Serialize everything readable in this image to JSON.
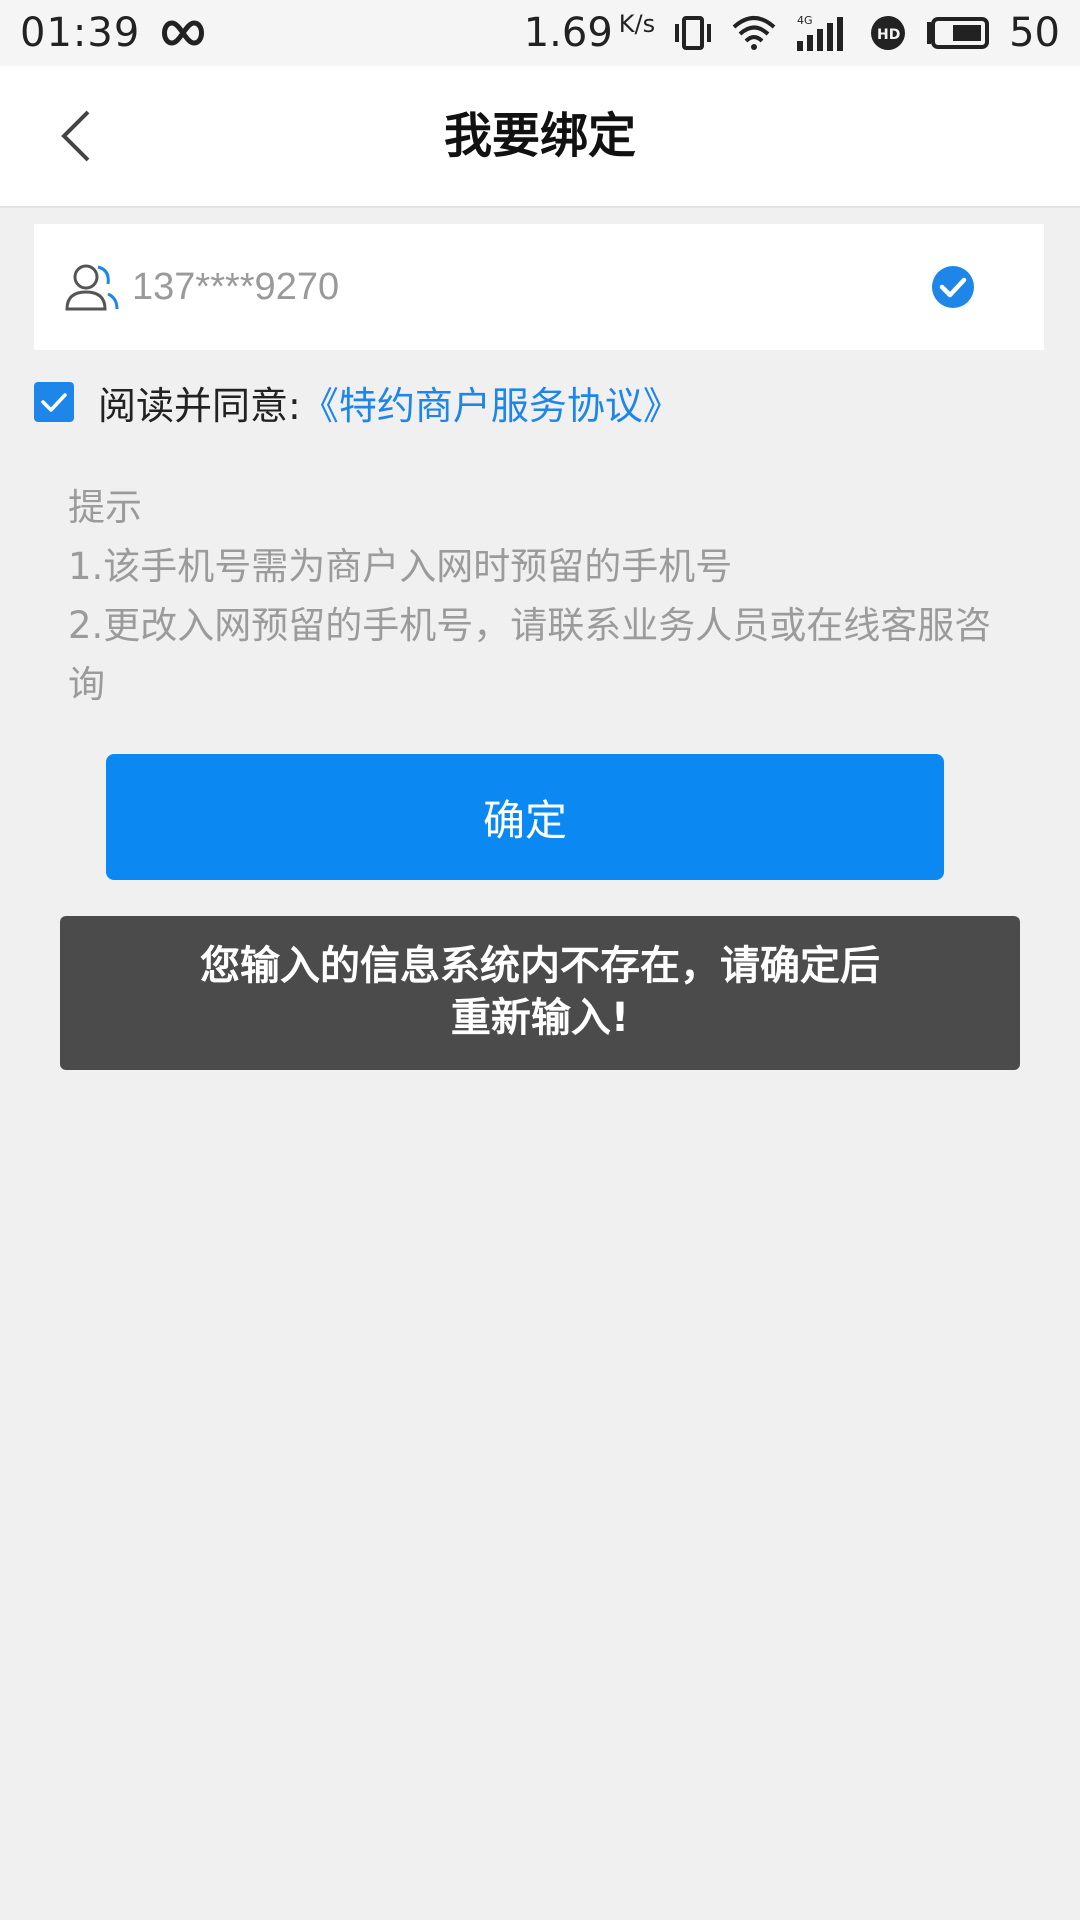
{
  "status_bar": {
    "time": "01:39",
    "speed": "1.69",
    "speed_unit": "K/s",
    "battery": "50",
    "network": "4G"
  },
  "header": {
    "title": "我要绑定"
  },
  "phone": {
    "value": "137****9270"
  },
  "agreement": {
    "prefix": "阅读并同意:",
    "link": "《特约商户服务协议》",
    "checked": true
  },
  "tips": {
    "title": "提示",
    "line1": "1.该手机号需为商户入网时预留的手机号",
    "line2": "2.更改入网预留的手机号，请联系业务人员或在线客服咨询"
  },
  "confirm": {
    "label": "确定"
  },
  "toast": {
    "line1": "您输入的信息系统内不存在，请确定后",
    "line2": "重新输入!"
  },
  "colors": {
    "accent": "#0b88f2",
    "toast_bg": "#4b4b4b",
    "page_bg": "#f0f0f0"
  }
}
